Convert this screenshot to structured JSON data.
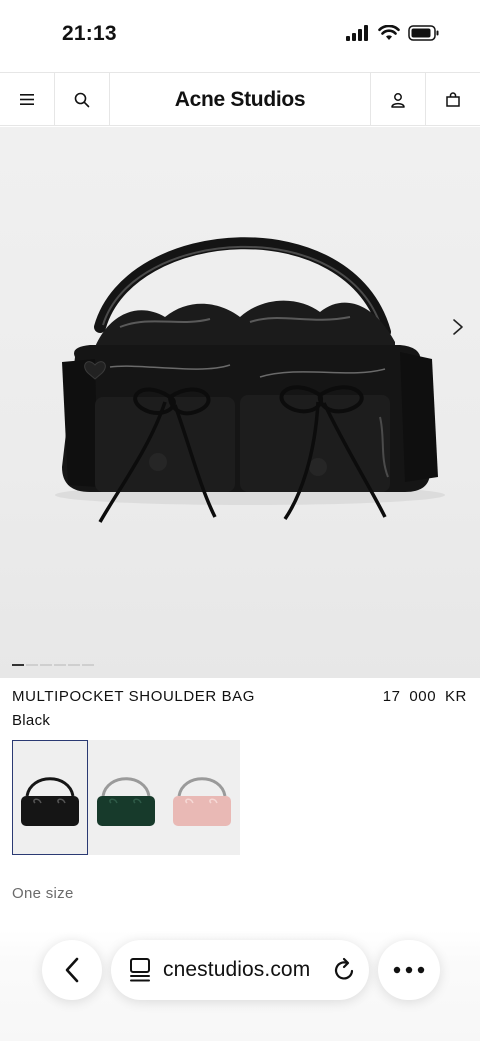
{
  "status_bar": {
    "time": "21:13"
  },
  "header": {
    "logo": "Acne Studios"
  },
  "icons": {
    "menu": "hamburger-icon",
    "search": "search-icon",
    "account": "user-icon",
    "bag": "shopping-bag-icon",
    "next": "chevron-right-icon",
    "back": "chevron-left-icon",
    "tabs": "tabs-icon",
    "reload": "reload-icon",
    "more": "more-icon"
  },
  "gallery": {
    "image_count": 6,
    "current_index": 1
  },
  "product": {
    "name": "MULTIPOCKET SHOULDER BAG",
    "price": "17 000 KR",
    "color": "Black",
    "swatches": [
      {
        "color_name": "black",
        "hex": "#151515",
        "selected": true
      },
      {
        "color_name": "green",
        "hex": "#173a2b",
        "selected": false
      },
      {
        "color_name": "pink",
        "hex": "#e9b9b5",
        "selected": false
      }
    ],
    "size": "One size"
  },
  "browser": {
    "url": "cnestudios.com"
  },
  "colors": {
    "accent_selected": "#2b3a73",
    "text_muted": "#6b6b6b"
  }
}
